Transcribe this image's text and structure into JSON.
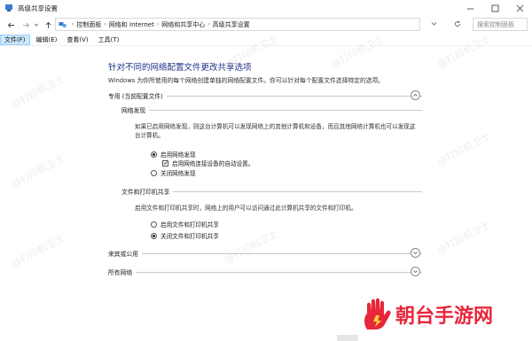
{
  "window": {
    "title": "高级共享设置",
    "icon": "network-share-icon"
  },
  "address": {
    "breadcrumbs": [
      "控制面板",
      "网络和 Internet",
      "网络和共享中心",
      "高级共享设置"
    ],
    "search_placeholder": "搜索控制面板"
  },
  "menu": {
    "items": [
      {
        "label": "文件(F)",
        "active": true
      },
      {
        "label": "编辑(E)",
        "active": false
      },
      {
        "label": "查看(V)",
        "active": false
      },
      {
        "label": "工具(T)",
        "active": false
      }
    ]
  },
  "main": {
    "heading": "针对不同的网络配置文件更改共享选项",
    "description": "Windows 为你所使用的每个网络创建单独的网络配置文件。你可以针对每个配置文件选择特定的选项。",
    "private_section": {
      "label": "专用 (当前配置文件)",
      "network_discovery": {
        "label": "网络发现",
        "text": "如果已启用网络发现，则这台计算机可以发现网络上的其他计算机和设备，而且其他网络计算机也可以发现这台计算机。",
        "option_on": "启用网络发现",
        "option_auto": "启用网络连接设备的自动设置。",
        "option_off": "关闭网络发现"
      },
      "file_printer": {
        "label": "文件和打印机共享",
        "text": "启用文件和打印机共享时，网络上的用户可以访问通过此计算机共享的文件和打印机。",
        "option_on": "启用文件和打印机共享",
        "option_off": "关闭文件和打印机共享"
      }
    },
    "guest_section": {
      "label": "来宾或公用"
    },
    "all_section": {
      "label": "所有网络"
    }
  },
  "watermark": {
    "text": "@打印机卫士"
  },
  "brand": {
    "text": "朝台手游网",
    "color": "#e8263a"
  }
}
